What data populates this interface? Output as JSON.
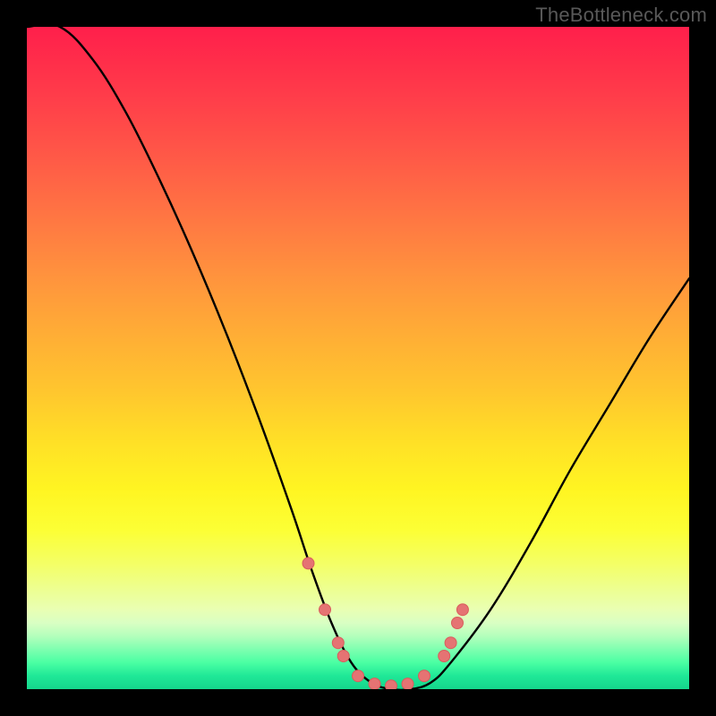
{
  "watermark": "TheBottleneck.com",
  "colors": {
    "page_bg": "#000000",
    "curve": "#000000",
    "marker_fill": "#e57373",
    "marker_stroke": "#d95c5c",
    "gradient_top": "#ff1f4b",
    "gradient_bottom": "#15d68c"
  },
  "chart_data": {
    "type": "line",
    "title": "",
    "xlabel": "",
    "ylabel": "",
    "xlim": [
      0,
      100
    ],
    "ylim": [
      0,
      100
    ],
    "grid": false,
    "legend": false,
    "series": [
      {
        "name": "bottleneck-curve",
        "x": [
          0,
          5,
          10,
          15,
          20,
          25,
          30,
          35,
          40,
          43,
          46,
          49,
          52,
          55,
          58,
          61,
          64,
          70,
          76,
          82,
          88,
          94,
          100
        ],
        "values": [
          100,
          100,
          95,
          87,
          77,
          66,
          54,
          41,
          27,
          18,
          10,
          4,
          1,
          0,
          0,
          1,
          4,
          12,
          22,
          33,
          43,
          53,
          62
        ]
      }
    ],
    "markers": [
      {
        "x": 42.5,
        "y": 19
      },
      {
        "x": 45.0,
        "y": 12
      },
      {
        "x": 47.0,
        "y": 7
      },
      {
        "x": 47.8,
        "y": 5
      },
      {
        "x": 50.0,
        "y": 2
      },
      {
        "x": 52.5,
        "y": 0.8
      },
      {
        "x": 55.0,
        "y": 0.5
      },
      {
        "x": 57.5,
        "y": 0.8
      },
      {
        "x": 60.0,
        "y": 2
      },
      {
        "x": 63.0,
        "y": 5
      },
      {
        "x": 64.0,
        "y": 7
      },
      {
        "x": 65.0,
        "y": 10
      },
      {
        "x": 65.8,
        "y": 12
      }
    ]
  }
}
